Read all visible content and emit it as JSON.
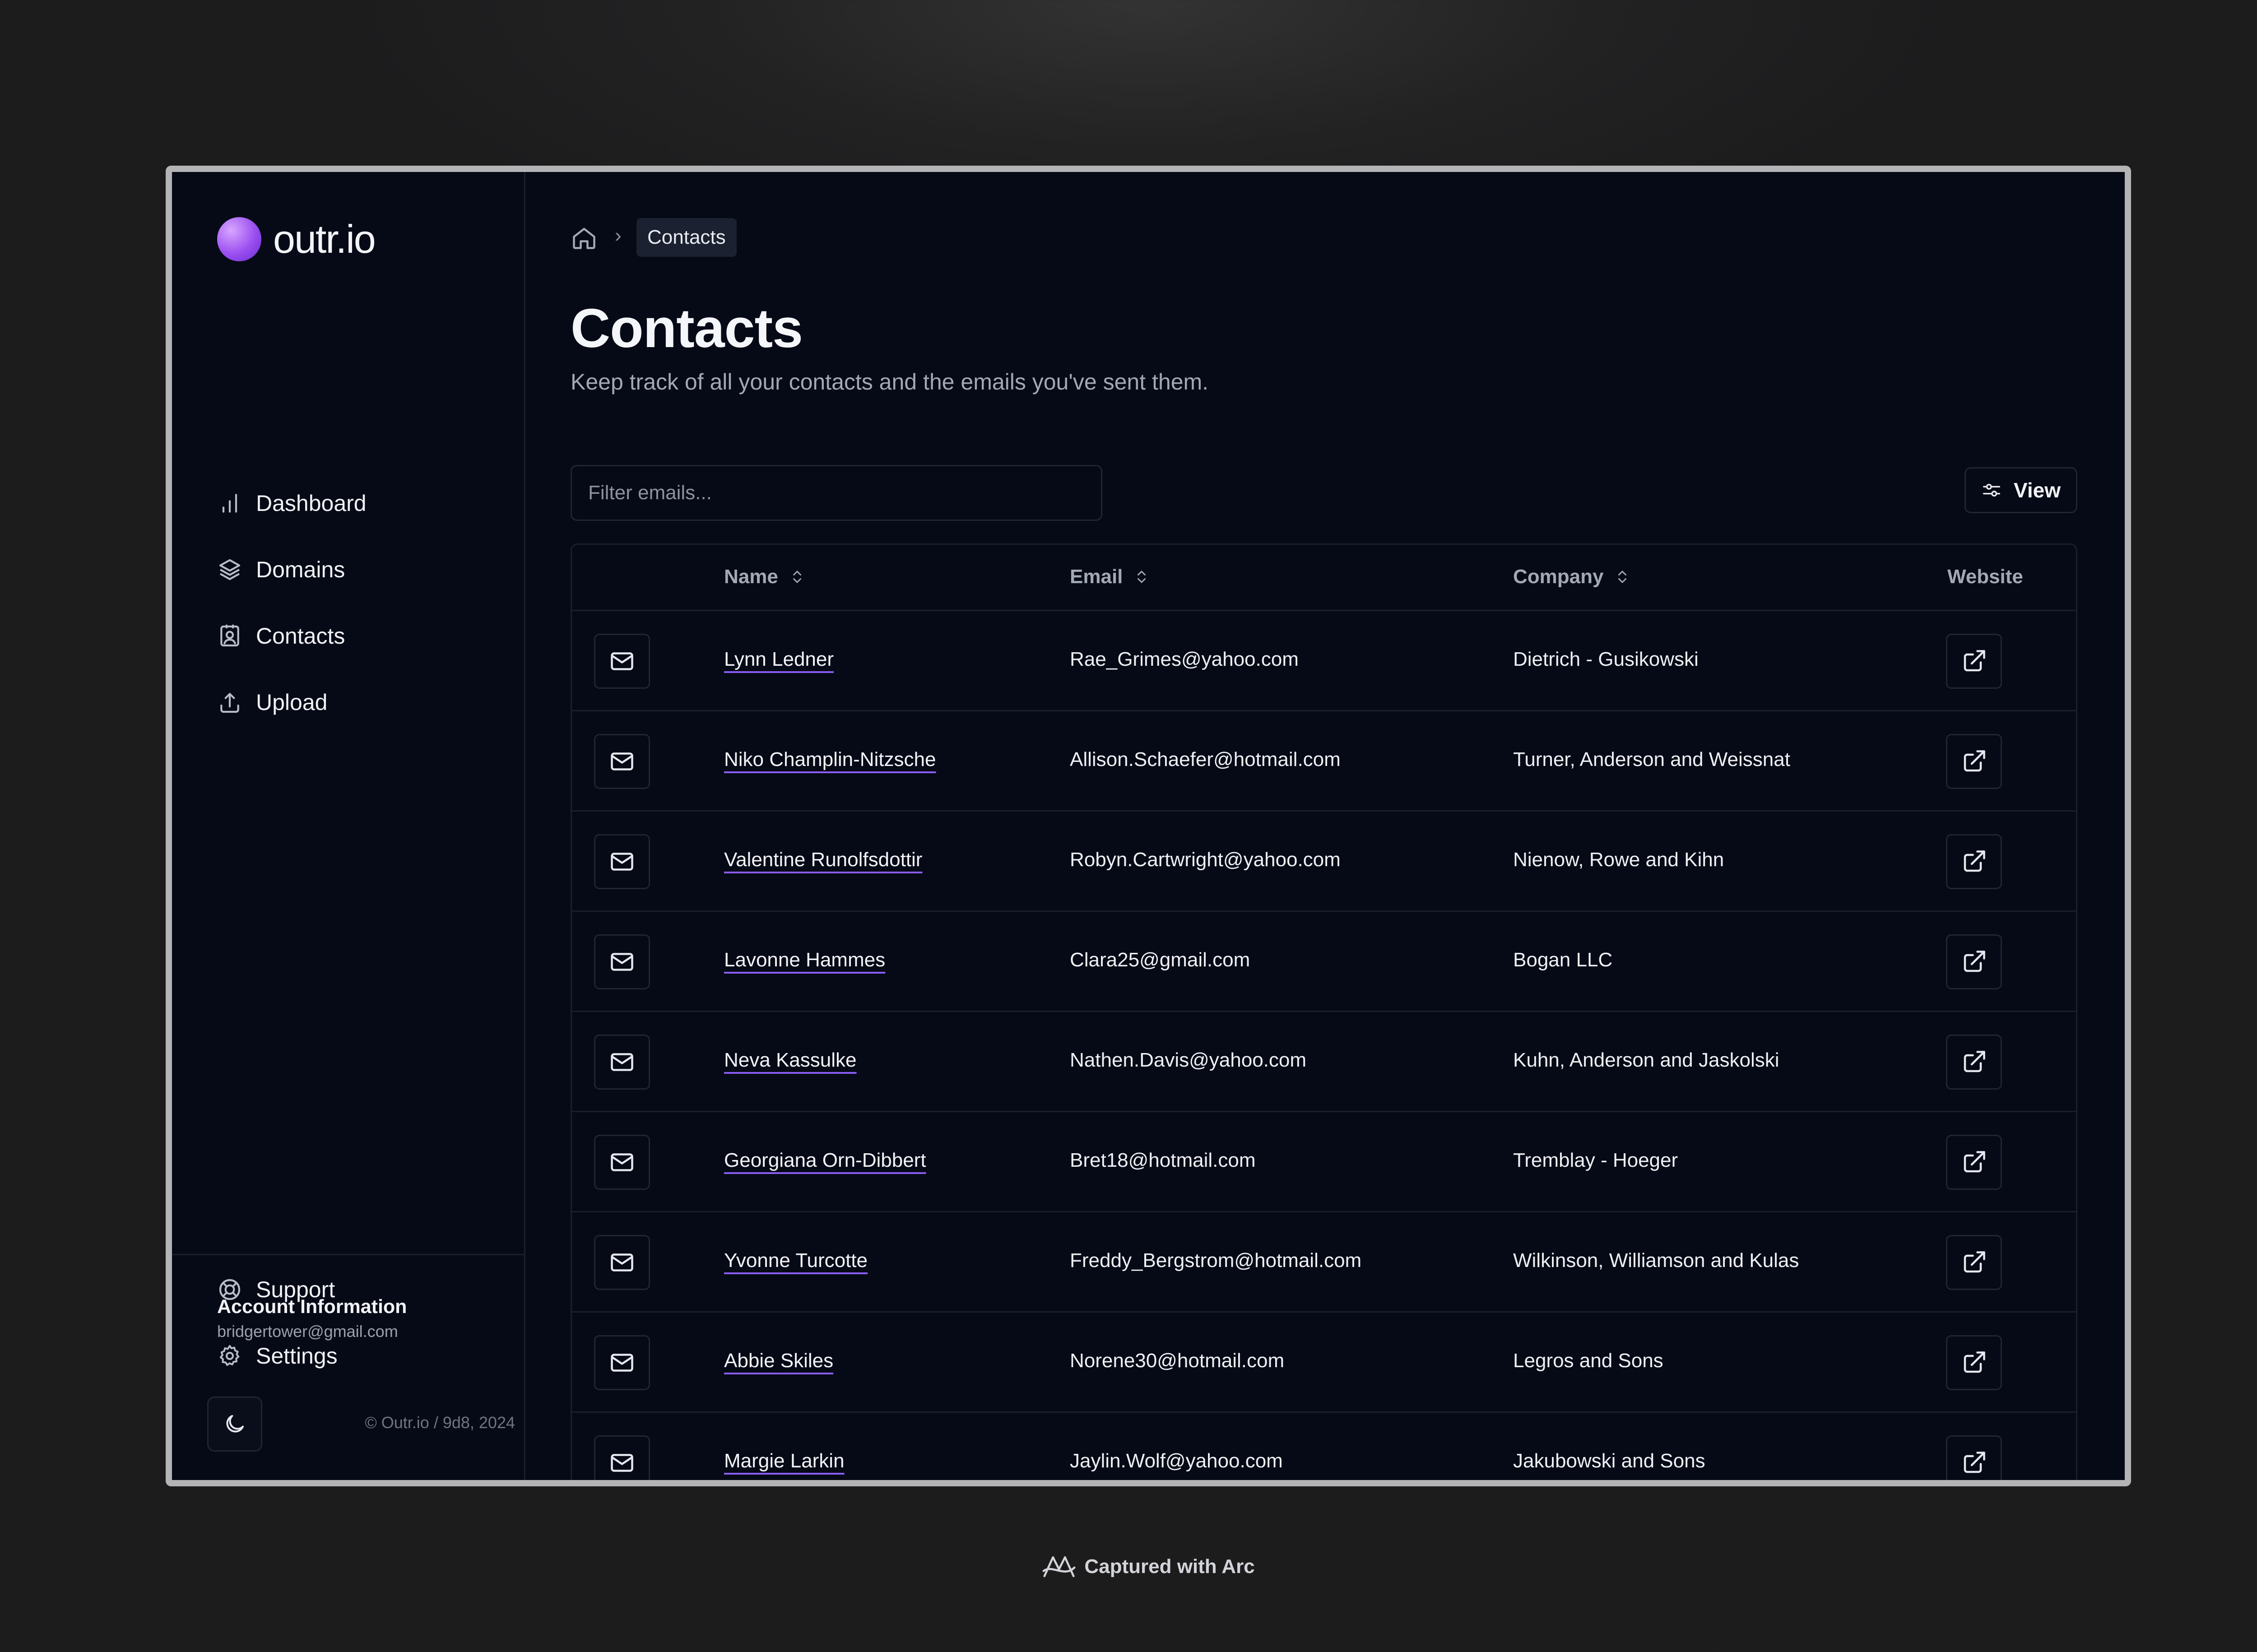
{
  "app": {
    "name": "outr.io"
  },
  "sidebar": {
    "nav": [
      {
        "label": "Dashboard",
        "icon": "bar-chart-icon"
      },
      {
        "label": "Domains",
        "icon": "layers-icon"
      },
      {
        "label": "Contacts",
        "icon": "contact-card-icon"
      },
      {
        "label": "Upload",
        "icon": "upload-icon"
      }
    ],
    "bottom_nav": [
      {
        "label": "Support",
        "icon": "lifebuoy-icon"
      },
      {
        "label": "Settings",
        "icon": "gear-icon"
      }
    ],
    "account": {
      "title": "Account Information",
      "email": "bridgertower@gmail.com"
    },
    "copyright": "© Outr.io / 9d8, 2024"
  },
  "breadcrumb": {
    "current": "Contacts"
  },
  "page": {
    "title": "Contacts",
    "subtitle": "Keep track of all your contacts and the emails you've sent them."
  },
  "toolbar": {
    "filter_placeholder": "Filter emails...",
    "view_label": "View"
  },
  "table": {
    "columns": [
      "Name",
      "Email",
      "Company",
      "Website"
    ],
    "rows": [
      {
        "name": "Lynn Ledner",
        "email": "Rae_Grimes@yahoo.com",
        "company": "Dietrich - Gusikowski"
      },
      {
        "name": "Niko Champlin-Nitzsche",
        "email": "Allison.Schaefer@hotmail.com",
        "company": "Turner, Anderson and Weissnat"
      },
      {
        "name": "Valentine Runolfsdottir",
        "email": "Robyn.Cartwright@yahoo.com",
        "company": "Nienow, Rowe and Kihn"
      },
      {
        "name": "Lavonne Hammes",
        "email": "Clara25@gmail.com",
        "company": "Bogan LLC"
      },
      {
        "name": "Neva Kassulke",
        "email": "Nathen.Davis@yahoo.com",
        "company": "Kuhn, Anderson and Jaskolski"
      },
      {
        "name": "Georgiana Orn-Dibbert",
        "email": "Bret18@hotmail.com",
        "company": "Tremblay - Hoeger"
      },
      {
        "name": "Yvonne Turcotte",
        "email": "Freddy_Bergstrom@hotmail.com",
        "company": "Wilkinson, Williamson and Kulas"
      },
      {
        "name": "Abbie Skiles",
        "email": "Norene30@hotmail.com",
        "company": "Legros and Sons"
      },
      {
        "name": "Margie Larkin",
        "email": "Jaylin.Wolf@yahoo.com",
        "company": "Jakubowski and Sons"
      }
    ]
  },
  "footer": {
    "capture_label": "Captured with Arc"
  },
  "colors": {
    "accent": "#8b5cf6",
    "background": "#060a16",
    "border": "#1a1f2c"
  }
}
